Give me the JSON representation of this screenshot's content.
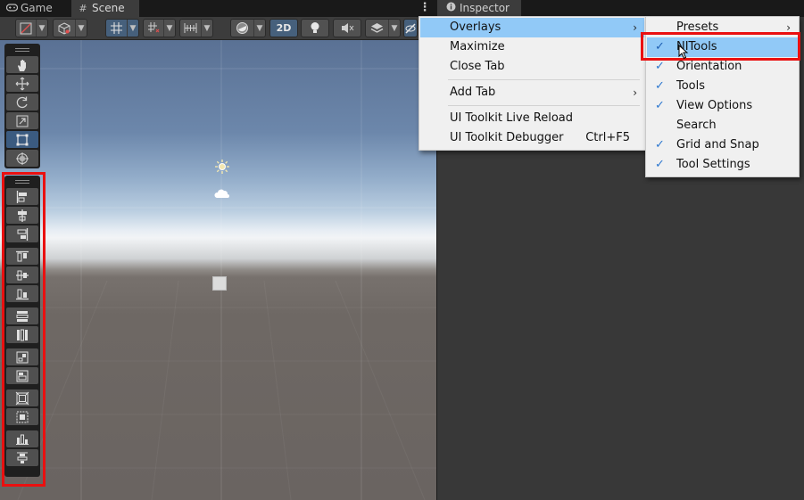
{
  "tabs": {
    "game": {
      "label": "Game",
      "icon": "gamepad-icon"
    },
    "scene": {
      "label": "Scene",
      "icon": "grid-icon"
    },
    "inspector": {
      "label": "Inspector",
      "icon": "info-icon"
    }
  },
  "toolbar": {
    "mode_2d_label": "2D",
    "buttons": [
      "draw-mode",
      "render-mode-cube",
      "grid-snap",
      "increment-snap",
      "ruler-snap",
      "shading-sphere",
      "2d-toggle",
      "lighting",
      "audio-mute",
      "effects-layers",
      "scene-visibility"
    ]
  },
  "tools_overlay": {
    "items": [
      "hand-tool",
      "move-tool",
      "rotate-tool",
      "scale-tool",
      "rect-tool",
      "transform-tool"
    ],
    "active": "rect-tool"
  },
  "nitools_overlay": {
    "groups": [
      [
        "align-left",
        "align-center-horizontal",
        "align-right"
      ],
      [
        "align-top",
        "align-center-vertical",
        "align-bottom"
      ],
      [
        "distribute-horizontal",
        "distribute-vertical"
      ],
      [
        "match-width",
        "match-height"
      ],
      [
        "fit-parent",
        "fit-children"
      ],
      [
        "snap-horizontal",
        "snap-vertical"
      ]
    ]
  },
  "main_menu": {
    "items": [
      {
        "label": "Overlays",
        "submenu": true,
        "highlighted": true
      },
      {
        "label": "Maximize"
      },
      {
        "label": "Close Tab"
      },
      {
        "separator": true
      },
      {
        "label": "Add Tab",
        "submenu": true
      },
      {
        "separator": true
      },
      {
        "label": "UI Toolkit Live Reload"
      },
      {
        "label": "UI Toolkit Debugger",
        "shortcut": "Ctrl+F5"
      }
    ]
  },
  "overlays_menu": {
    "items": [
      {
        "label": "Presets",
        "submenu": true,
        "checked": false
      },
      {
        "label": "NITools",
        "checked": true,
        "highlighted": true
      },
      {
        "label": "Orientation",
        "checked": true
      },
      {
        "label": "Tools",
        "checked": true
      },
      {
        "label": "View Options",
        "checked": true
      },
      {
        "label": "Search",
        "checked": false
      },
      {
        "label": "Grid and Snap",
        "checked": true
      },
      {
        "label": "Tool Settings",
        "checked": true
      }
    ]
  },
  "symbols": {
    "check": "✓",
    "submenu_arrow": "›"
  },
  "colors": {
    "highlight": "#91c9f7",
    "annotation_red": "#ea1010",
    "active_blue": "#3b5b80"
  }
}
